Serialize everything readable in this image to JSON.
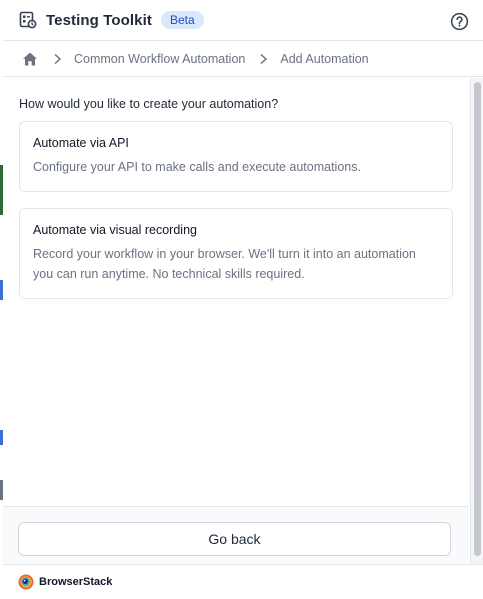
{
  "header": {
    "title": "Testing Toolkit",
    "badge": "Beta"
  },
  "breadcrumb": {
    "items": [
      "Common Workflow Automation",
      "Add Automation"
    ]
  },
  "main": {
    "question": "How would you like to create your automation?",
    "options": [
      {
        "title": "Automate via API",
        "description": "Configure your API to make calls and execute automations."
      },
      {
        "title": "Automate via visual recording",
        "description": "Record your workflow in your browser. We'll turn it into an automation you can run anytime. No technical skills required."
      }
    ]
  },
  "footer": {
    "go_back_label": "Go back",
    "brand": "BrowserStack"
  },
  "colors": {
    "badge_bg": "#dbe7fb",
    "badge_text": "#1d4fbf",
    "muted_text": "#6b7280"
  },
  "icons": [
    "toolkit-icon",
    "help-icon",
    "home-icon",
    "chevron-right-icon",
    "browserstack-logo"
  ]
}
